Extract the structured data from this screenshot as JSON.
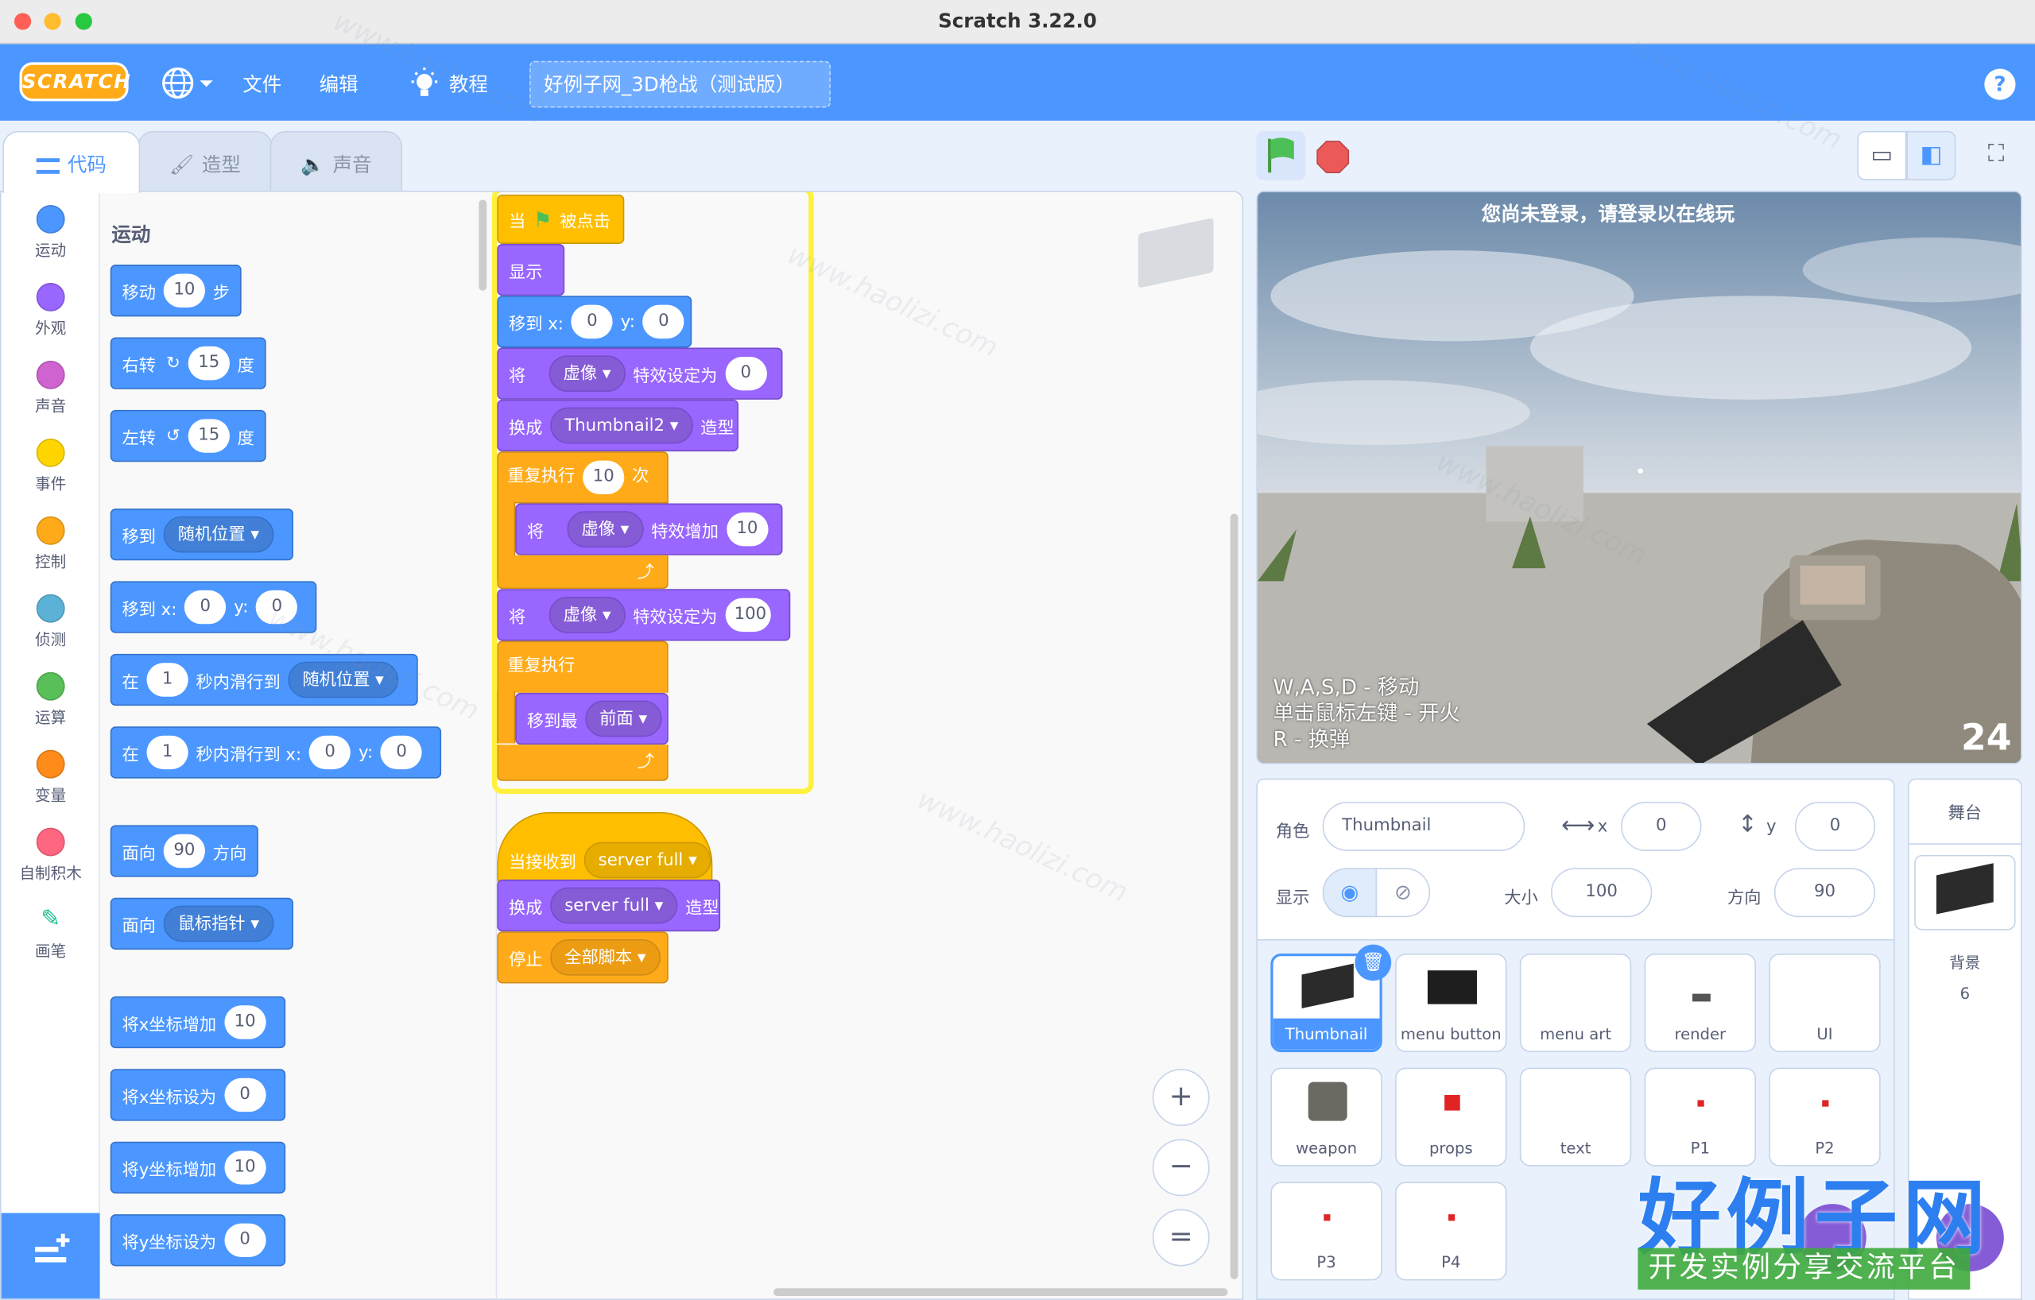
{
  "window": {
    "title": "Scratch 3.22.0"
  },
  "menu": {
    "logo": "SCRATCH",
    "file": "文件",
    "edit": "编辑",
    "tutorials": "教程",
    "project_title": "好例子网_3D枪战（测试版）",
    "help": "?"
  },
  "tabs": {
    "code": "代码",
    "costumes": "造型",
    "sounds": "声音"
  },
  "categories": [
    {
      "label": "运动",
      "color": "#4c97ff"
    },
    {
      "label": "外观",
      "color": "#9966ff"
    },
    {
      "label": "声音",
      "color": "#cf63cf"
    },
    {
      "label": "事件",
      "color": "#ffd500"
    },
    {
      "label": "控制",
      "color": "#ffab19"
    },
    {
      "label": "侦测",
      "color": "#5cb1d6"
    },
    {
      "label": "运算",
      "color": "#59c059"
    },
    {
      "label": "变量",
      "color": "#ff8c1a"
    },
    {
      "label": "自制积木",
      "color": "#ff6680"
    },
    {
      "label": "画笔",
      "color": "#0fbd8c"
    }
  ],
  "palette": {
    "section": "运动",
    "move": {
      "pre": "移动",
      "val": "10",
      "post": "步"
    },
    "turn_right": {
      "pre": "右转",
      "val": "15",
      "post": "度"
    },
    "turn_left": {
      "pre": "左转",
      "val": "15",
      "post": "度"
    },
    "goto": {
      "pre": "移到",
      "dd": "随机位置"
    },
    "goto_xy": {
      "pre": "移到 x:",
      "x": "0",
      "y_label": "y:",
      "y": "0"
    },
    "glide": {
      "pre": "在",
      "val": "1",
      "mid": "秒内滑行到",
      "dd": "随机位置"
    },
    "glide_xy": {
      "pre": "在",
      "val": "1",
      "mid": "秒内滑行到 x:",
      "x": "0",
      "y_label": "y:",
      "y": "0"
    },
    "point_dir": {
      "pre": "面向",
      "val": "90",
      "post": "方向"
    },
    "point_towards": {
      "pre": "面向",
      "dd": "鼠标指针"
    },
    "change_x": {
      "pre": "将x坐标增加",
      "val": "10"
    },
    "set_x": {
      "pre": "将x坐标设为",
      "val": "0"
    },
    "change_y": {
      "pre": "将y坐标增加",
      "val": "10"
    },
    "set_y": {
      "pre": "将y坐标设为",
      "val": "0"
    }
  },
  "script1": {
    "hat": {
      "pre": "当",
      "post": "被点击"
    },
    "show": "显示",
    "goto": {
      "pre": "移到 x:",
      "x": "0",
      "y_label": "y:",
      "y": "0"
    },
    "set_effect": {
      "pre": "将",
      "dd": "虚像",
      "mid": "特效设定为",
      "val": "0"
    },
    "switch_costume": {
      "pre": "换成",
      "dd": "Thumbnail2",
      "post": "造型"
    },
    "repeat": {
      "pre": "重复执行",
      "val": "10",
      "post": "次"
    },
    "change_effect": {
      "pre": "将",
      "dd": "虚像",
      "mid": "特效增加",
      "val": "10"
    },
    "set_effect2": {
      "pre": "将",
      "dd": "虚像",
      "mid": "特效设定为",
      "val": "100"
    },
    "forever": "重复执行",
    "front": {
      "pre": "移到最",
      "dd": "前面"
    }
  },
  "script2": {
    "hat": {
      "pre": "当接收到",
      "dd": "server full"
    },
    "switch_costume": {
      "pre": "换成",
      "dd": "server full",
      "post": "造型"
    },
    "stop": {
      "pre": "停止",
      "dd": "全部脚本"
    }
  },
  "zoom": {
    "in": "+",
    "out": "−",
    "reset": "="
  },
  "stage": {
    "login_notice": "您尚未登录，请登录以在线玩",
    "controls": [
      "W,A,S,D - 移动",
      "单击鼠标左键 - 开火",
      "R - 换弹"
    ],
    "ammo": "24"
  },
  "sprite_info": {
    "sprite_label": "角色",
    "sprite_name": "Thumbnail",
    "x_label": "x",
    "x": "0",
    "y_label": "y",
    "y": "0",
    "show_label": "显示",
    "size_label": "大小",
    "size": "100",
    "direction_label": "方向",
    "direction": "90"
  },
  "sprites": [
    {
      "name": "Thumbnail",
      "selected": true
    },
    {
      "name": "menu button"
    },
    {
      "name": "menu art"
    },
    {
      "name": "render"
    },
    {
      "name": "UI"
    },
    {
      "name": "weapon"
    },
    {
      "name": "props"
    },
    {
      "name": "text"
    },
    {
      "name": "P1"
    },
    {
      "name": "P2"
    },
    {
      "name": "P3"
    },
    {
      "name": "P4"
    }
  ],
  "stage_pane": {
    "title": "舞台",
    "backdrops_label": "背景",
    "backdrops_count": "6"
  },
  "watermark": {
    "site": "www.haolizi.com",
    "logo_text": "好例子网",
    "slogan": "开发实例分享交流平台"
  }
}
